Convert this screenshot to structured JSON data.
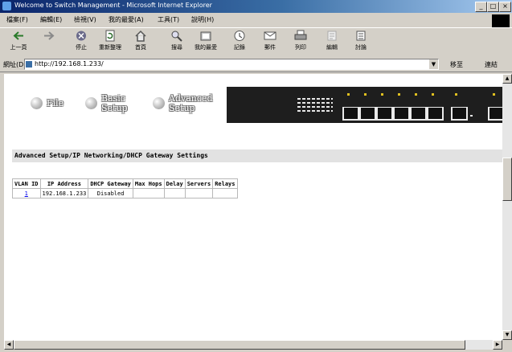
{
  "window": {
    "title": "Welcome to Switch Management - Microsoft Internet Explorer"
  },
  "menu": {
    "items": [
      "檔案(F)",
      "編輯(E)",
      "檢視(V)",
      "我的最愛(A)",
      "工具(T)",
      "說明(H)"
    ]
  },
  "toolbar": {
    "items": [
      {
        "label": "上一頁",
        "icon": "back-arrow-icon"
      },
      {
        "label": "",
        "icon": "forward-arrow-icon"
      },
      {
        "label": "停止",
        "icon": "stop-icon"
      },
      {
        "label": "重新整理",
        "icon": "refresh-icon"
      },
      {
        "label": "首頁",
        "icon": "home-icon"
      },
      {
        "label": "搜尋",
        "icon": "search-icon"
      },
      {
        "label": "我的最愛",
        "icon": "favorites-icon"
      },
      {
        "label": "記錄",
        "icon": "history-icon"
      },
      {
        "label": "郵件",
        "icon": "mail-icon"
      },
      {
        "label": "列印",
        "icon": "print-icon"
      },
      {
        "label": "編輯",
        "icon": "edit-icon"
      },
      {
        "label": "討論",
        "icon": "discuss-icon"
      }
    ]
  },
  "address": {
    "label": "網址(D)",
    "value": "http://192.168.1.233/",
    "go_label": "移至",
    "links_label": "連結"
  },
  "nav": {
    "file": "File",
    "basic": [
      "Basic",
      "Setup"
    ],
    "advanced": [
      "Advanced",
      "Setup"
    ]
  },
  "section_title": "Advanced Setup/IP Networking/DHCP Gateway Settings",
  "table": {
    "headers": [
      "VLAN ID",
      "IP Address",
      "DHCP Gateway",
      "Max Hops",
      "Delay",
      "Servers",
      "Relays"
    ],
    "rows": [
      {
        "vlan": "1",
        "ip": "192.168.1.233",
        "gateway": "Disabled",
        "hops": "",
        "delay": "",
        "servers": "",
        "relays": ""
      }
    ]
  },
  "colors": {
    "titlebar_start": "#0a246a",
    "chrome": "#d4d0c8",
    "link": "#0000ee",
    "switch_panel": "#1e1e1e"
  }
}
